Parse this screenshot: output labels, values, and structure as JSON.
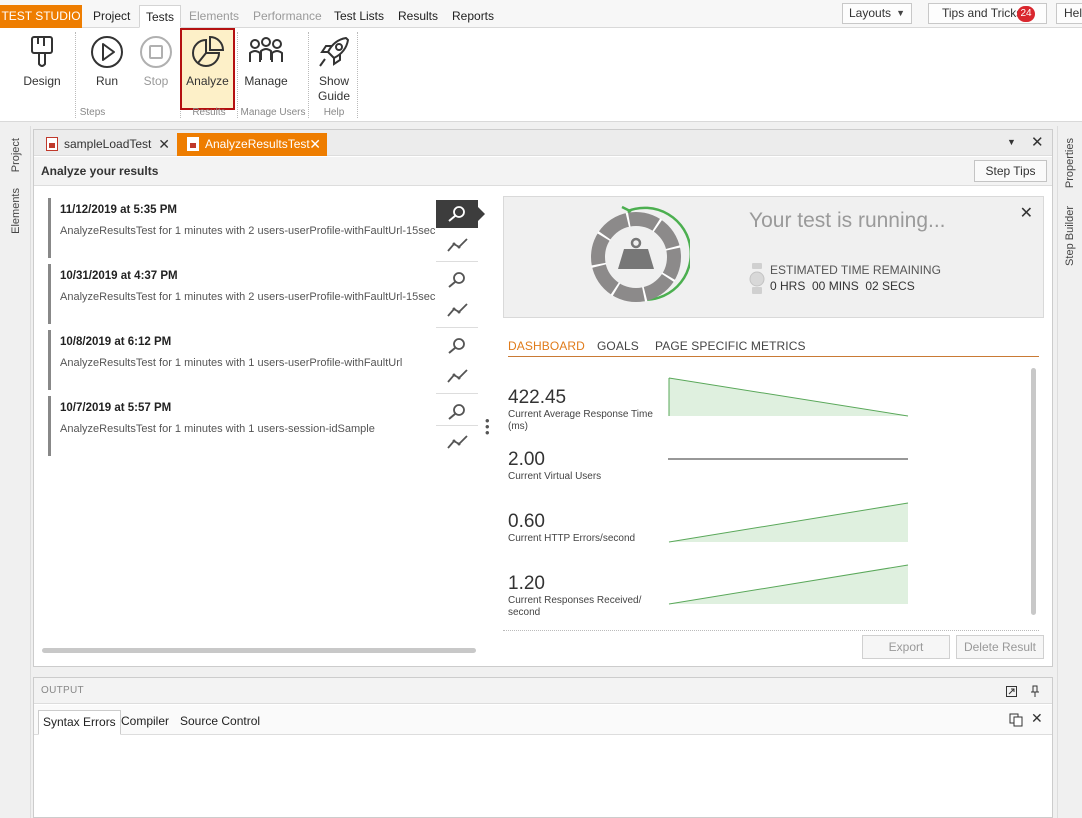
{
  "app": {
    "brand": "TEST STUDIO",
    "menu": [
      "Project",
      "Tests",
      "Elements",
      "Performance",
      "Test Lists",
      "Results",
      "Reports"
    ],
    "layouts_label": "Layouts",
    "tips_label": "Tips and Tricks",
    "tips_count": "24",
    "help_label": "Hel"
  },
  "ribbon": {
    "design": "Design",
    "run": "Run",
    "stop": "Stop",
    "analyze": "Analyze",
    "manage": "Manage",
    "show_guide_1": "Show",
    "show_guide_2": "Guide",
    "groups": {
      "steps": "Steps",
      "results": "Results",
      "manage_users": "Manage Users",
      "help": "Help"
    }
  },
  "sidebar_left": [
    "Project",
    "Elements"
  ],
  "sidebar_right": [
    "Properties",
    "Step Builder"
  ],
  "doc_tabs": [
    {
      "label": "sampleLoadTest"
    },
    {
      "label": "AnalyzeResultsTest"
    }
  ],
  "subheader": {
    "title": "Analyze your results",
    "step_tips": "Step Tips"
  },
  "results": [
    {
      "date": "11/12/2019 at 5:35 PM",
      "desc": "AnalyzeResultsTest for 1 minutes with 2 users-userProfile-withFaultUrl-15sec"
    },
    {
      "date": "10/31/2019 at 4:37 PM",
      "desc": "AnalyzeResultsTest for 1 minutes with 2 users-userProfile-withFaultUrl-15sec"
    },
    {
      "date": "10/8/2019 at 6:12 PM",
      "desc": "AnalyzeResultsTest for 1 minutes with 1 users-userProfile-withFaultUrl"
    },
    {
      "date": "10/7/2019 at 5:57 PM",
      "desc": "AnalyzeResultsTest for 1 minutes with 1 users-session-idSample"
    }
  ],
  "running": {
    "title": "Your test is running...",
    "eta_label": "ESTIMATED TIME REMAINING",
    "eta_value": "0 HRS  00 MINS  02 SECS"
  },
  "panel_tabs": [
    "DASHBOARD",
    "GOALS",
    "PAGE SPECIFIC METRICS"
  ],
  "metrics": [
    {
      "value": "422.45",
      "label": "Current Average Response Time (ms)",
      "trend": "down"
    },
    {
      "value": "2.00",
      "label": "Current Virtual Users",
      "trend": "flat"
    },
    {
      "value": "0.60",
      "label": "Current HTTP Errors/second",
      "trend": "up"
    },
    {
      "value": "1.20",
      "label": "Current Responses Received/ second",
      "trend": "up"
    }
  ],
  "buttons": {
    "export": "Export",
    "delete": "Delete Result"
  },
  "output": {
    "title": "OUTPUT",
    "tabs": [
      "Syntax Errors",
      "Compiler",
      "Source Control"
    ]
  },
  "colors": {
    "accent": "#ee7d00",
    "highlight_border": "#b41010",
    "chart_line": "#5aa85a",
    "chart_fill": "#dff0df"
  }
}
